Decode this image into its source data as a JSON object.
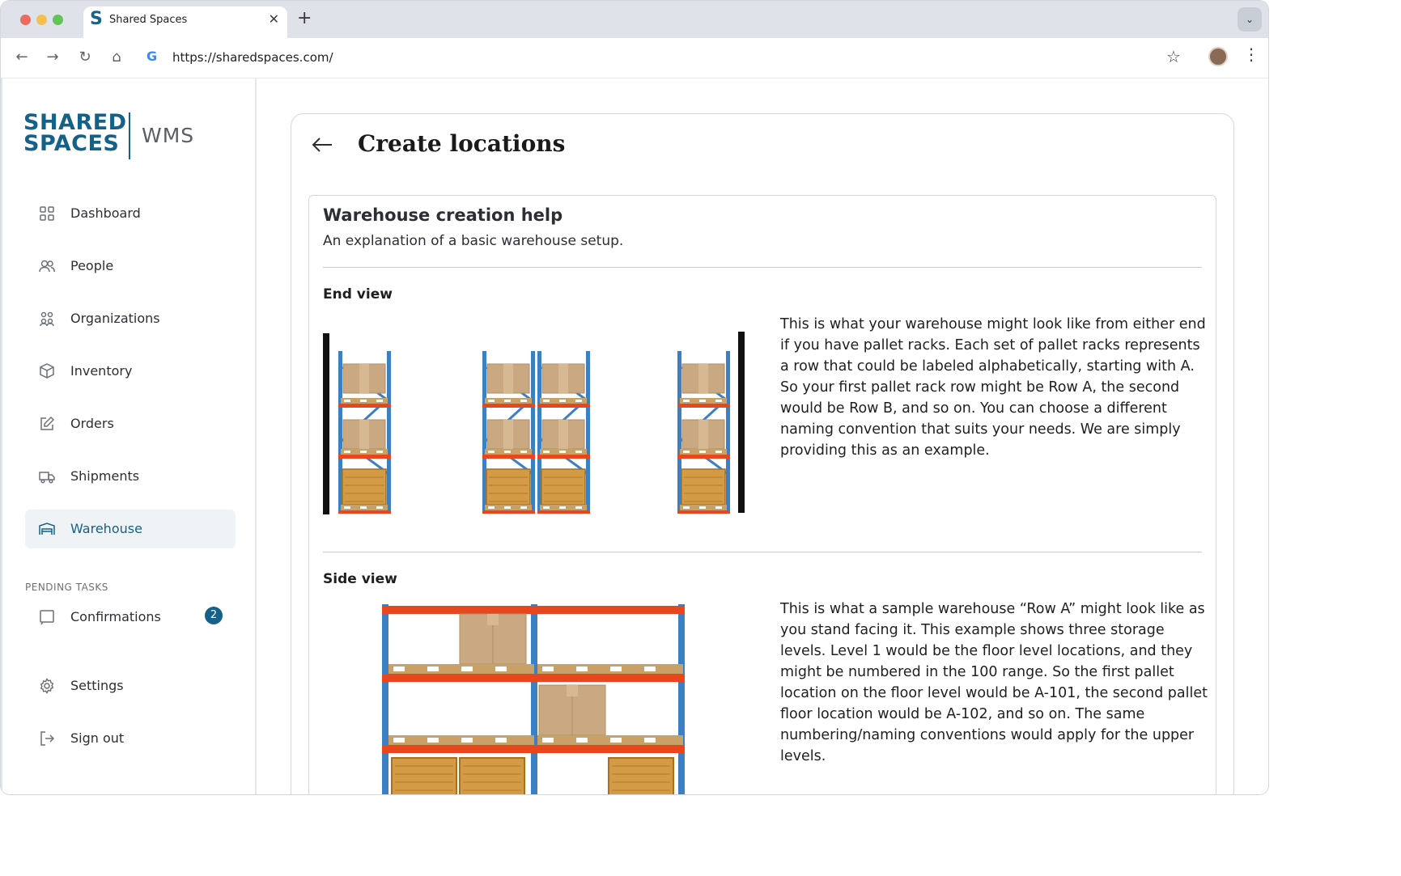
{
  "browser": {
    "tab_title": "Shared Spaces",
    "tab_favicon_letter": "S",
    "url": "https://sharedspaces.com/"
  },
  "brand": {
    "logo_line1": "SHARED",
    "logo_line2": "SPACES",
    "product": "WMS",
    "accent": "#146189"
  },
  "sidebar": {
    "items": [
      {
        "label": "Dashboard",
        "icon": "grid-icon"
      },
      {
        "label": "People",
        "icon": "people-icon"
      },
      {
        "label": "Organizations",
        "icon": "organizations-icon"
      },
      {
        "label": "Inventory",
        "icon": "box-icon"
      },
      {
        "label": "Orders",
        "icon": "edit-icon"
      },
      {
        "label": "Shipments",
        "icon": "truck-icon"
      },
      {
        "label": "Warehouse",
        "icon": "warehouse-icon",
        "active": true
      }
    ],
    "pending_label": "PENDING TASKS",
    "confirmations": {
      "label": "Confirmations",
      "count": "2"
    },
    "settings_label": "Settings",
    "signout_label": "Sign out"
  },
  "page": {
    "title": "Create locations"
  },
  "help": {
    "title": "Warehouse creation help",
    "subtitle": "An explanation of a basic warehouse setup.",
    "end_view": {
      "heading": "End view",
      "body": "This is what your warehouse might look like from either end if you have pallet racks.  Each set of pallet racks represents a row that could be labeled alphabetically, starting with A.  So your first pallet rack row might be Row A, the second would be Row B, and so on.  You can choose a different naming convention that suits your needs.  We are simply providing this as an example."
    },
    "side_view": {
      "heading": "Side view",
      "body": "This is what a sample warehouse “Row A” might look like as you stand facing it.  This example shows three storage levels. Level 1 would be the floor level locations, and they might be numbered in the 100 range.  So the first pallet location on the floor level would be A-101, the second pallet floor location would be A-102, and so on.  The same numbering/naming conventions would apply for the upper levels."
    }
  }
}
